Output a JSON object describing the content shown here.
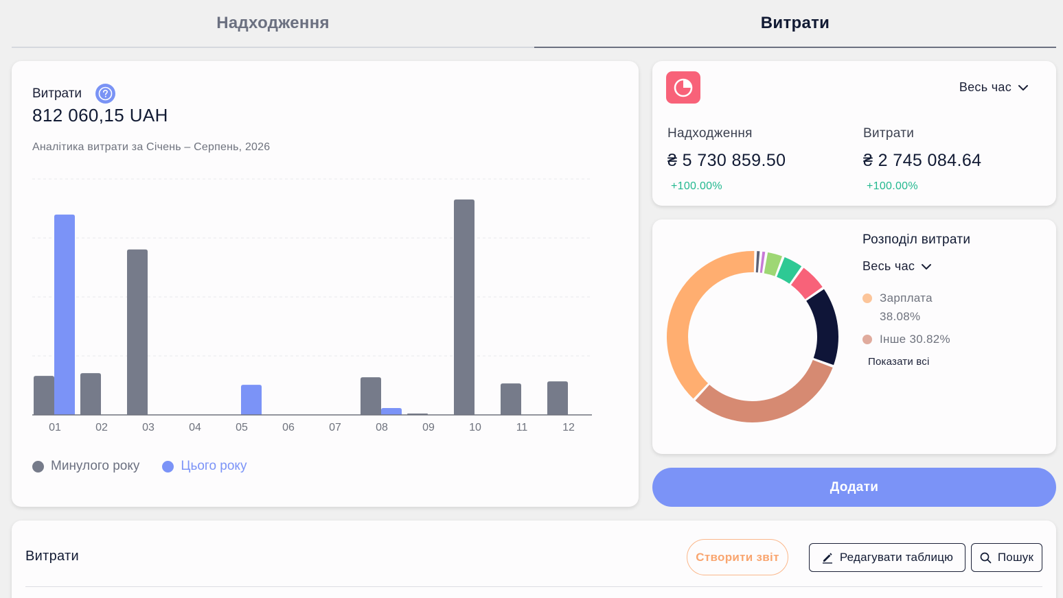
{
  "tabs": [
    {
      "label": "Надходження",
      "active": false
    },
    {
      "label": "Витрати",
      "active": true
    }
  ],
  "main": {
    "title": "Витрати",
    "total": "812 060,15 UAH",
    "subtitle": "Аналітика витрати за Січень – Серпень, 2026",
    "help_icon": "question-circle-icon",
    "legend": [
      {
        "label": "Минулого року",
        "color": "#767b8a"
      },
      {
        "label": "Цього року",
        "color": "#7b93f7"
      }
    ]
  },
  "chart_data": {
    "type": "bar",
    "categories": [
      "01",
      "02",
      "03",
      "04",
      "05",
      "06",
      "07",
      "08",
      "09",
      "10",
      "11",
      "12"
    ],
    "series": [
      {
        "name": "Минулого року",
        "color": "#767b8a",
        "values": [
          57,
          61,
          242,
          0,
          0,
          0,
          0,
          55,
          2,
          315,
          46,
          49
        ]
      },
      {
        "name": "Цього року",
        "color": "#7b93f7",
        "values": [
          293,
          0,
          0,
          0,
          44,
          0,
          0,
          10,
          0,
          0,
          0,
          0
        ]
      }
    ],
    "ylim": [
      0,
      345
    ],
    "grid": true,
    "legend_position": "bottom-left"
  },
  "summary": {
    "icon": "pie-chart-icon",
    "period": "Весь час",
    "income_label": "Надходження",
    "income_value": "₴ 5 730 859.50",
    "income_change": "+100.00%",
    "expense_label": "Витрати",
    "expense_value": "₴ 2 745 084.64",
    "expense_change": "+100.00%"
  },
  "distribution": {
    "title": "Розподіл витрати",
    "period": "Весь час",
    "legend": [
      {
        "label": "Зарплата",
        "value": "38.08%",
        "color": "#fcc59a"
      },
      {
        "label": "Інше",
        "value": "30.82%",
        "color": "#e0ab9d"
      }
    ],
    "show_all": "Показати всі",
    "donut_data": [
      {
        "value": 1.0,
        "color": "#5d6173"
      },
      {
        "value": 1.0,
        "color": "#c77ad6"
      },
      {
        "value": 3.2,
        "color": "#9ed774"
      },
      {
        "value": 4.0,
        "color": "#2ec994"
      },
      {
        "value": 5.4,
        "color": "#f86279"
      },
      {
        "value": 15.0,
        "color": "#0f1538"
      },
      {
        "value": 30.82,
        "color": "#d68a72"
      },
      {
        "value": 38.08,
        "color": "#ffae70"
      }
    ]
  },
  "actions": {
    "add_label": "Додати"
  },
  "table_section": {
    "title": "Витрати",
    "create_report": "Створити звіт",
    "edit_table": "Редагувати таблицю",
    "search": "Пошук"
  }
}
